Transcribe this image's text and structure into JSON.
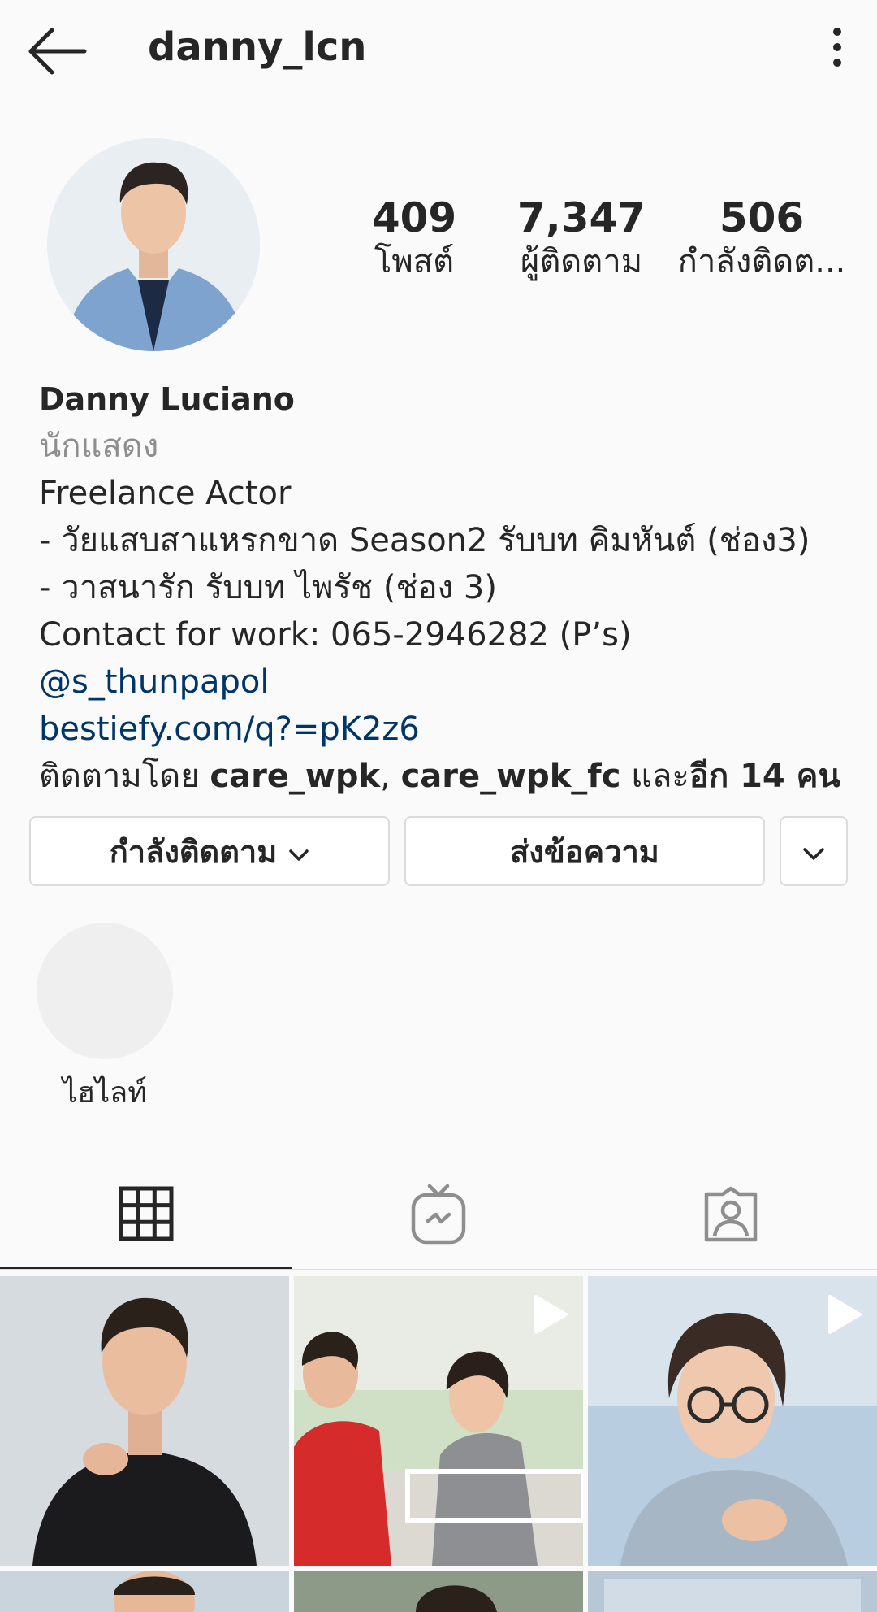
{
  "header": {
    "username": "danny_lcn"
  },
  "stats": {
    "posts": {
      "value": "409",
      "label": "โพสต์"
    },
    "followers": {
      "value": "7,347",
      "label": "ผู้ติดตาม"
    },
    "following": {
      "value": "506",
      "label": "กำลังติดต..."
    }
  },
  "bio": {
    "name": "Danny Luciano",
    "category": "นักแสดง",
    "line1": "Freelance Actor",
    "line2": "- วัยแสบสาแหรกขาด Season2 รับบท คิมหันต์ (ช่อง3)",
    "line3": "- วาสนารัก รับบท ไพรัช (ช่อง 3)",
    "contact_prefix": "Contact for work: 065-2946282 (P’s) ",
    "contact_mention": "@s_thunpapol",
    "website": "bestiefy.com/q?=pK2z6",
    "followed_by_prefix": "ติดตามโดย ",
    "followed_by_user1": "care_wpk",
    "followed_by_sep": ", ",
    "followed_by_user2": "care_wpk_fc",
    "followed_by_and": " และ",
    "followed_by_others": "อีก 14 คน"
  },
  "actions": {
    "following_label": "กำลังติดตาม",
    "message_label": "ส่งข้อความ"
  },
  "highlights": [
    {
      "label": "ไฮไลท์"
    }
  ],
  "tabs": [
    {
      "icon": "grid-icon",
      "active": true
    },
    {
      "icon": "igtv-icon",
      "active": false
    },
    {
      "icon": "tagged-icon",
      "active": false
    }
  ],
  "grid_posts": [
    {
      "type": "photo"
    },
    {
      "type": "video"
    },
    {
      "type": "video"
    }
  ],
  "colors": {
    "text": "#262626",
    "muted": "#8e8e8e",
    "link": "#003569",
    "border": "#dbdbdb",
    "background": "#fafafa"
  }
}
